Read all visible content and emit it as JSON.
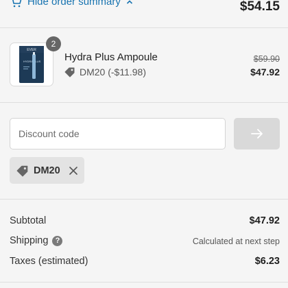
{
  "summary": {
    "toggle_label": "Hide order summary",
    "total": "$54.15"
  },
  "product": {
    "name": "Hydra Plus Ampoule",
    "quantity": "2",
    "discount_label": "DM20 (-$11.98)",
    "original_price": "$59.90",
    "price": "$47.92",
    "image_brand": "EVER",
    "image_text": "HYDRA PLUS"
  },
  "discount": {
    "placeholder": "Discount code",
    "applied_code": "DM20"
  },
  "totals": {
    "subtotal_label": "Subtotal",
    "subtotal": "$47.92",
    "shipping_label": "Shipping",
    "shipping_help": "?",
    "shipping_value": "Calculated at next step",
    "taxes_label": "Taxes (estimated)",
    "taxes": "$6.23"
  },
  "colors": {
    "link": "#1773b0",
    "background": "#f5f5f5",
    "button_disabled": "#d9d9d9"
  },
  "icons": {
    "cart": "cart-icon",
    "chevron": "chevron-up-icon",
    "tag": "tag-icon",
    "arrow": "arrow-right-icon",
    "close": "close-icon",
    "help": "help-icon"
  }
}
